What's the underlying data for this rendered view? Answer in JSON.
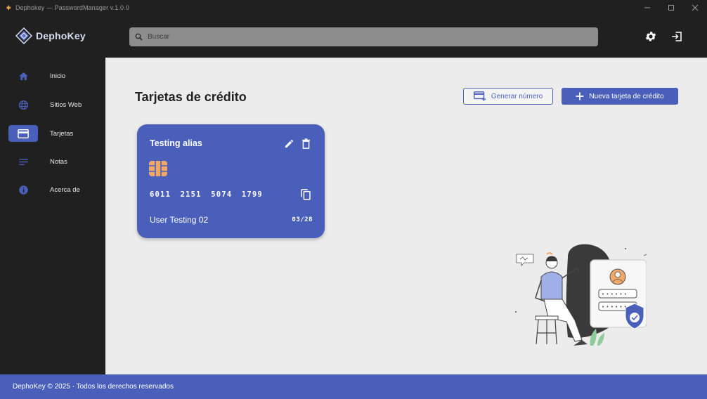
{
  "window": {
    "title": "Dephokey — PasswordManager v.1.0.0",
    "controls": [
      "minimize-icon",
      "maximize-icon",
      "close-icon"
    ]
  },
  "header": {
    "logo_text": "DephoKey",
    "search_placeholder": "Buscar",
    "icons": [
      "gear-icon",
      "logout-icon"
    ]
  },
  "sidebar": {
    "items": [
      {
        "label": "Inicio",
        "icon": "home-icon",
        "active": false
      },
      {
        "label": "Sitios Web",
        "icon": "globe-icon",
        "active": false
      },
      {
        "label": "Tarjetas",
        "icon": "credit-card-icon",
        "active": true
      },
      {
        "label": "Notas",
        "icon": "notes-icon",
        "active": false
      },
      {
        "label": "Acerca de",
        "icon": "info-icon",
        "active": false
      }
    ]
  },
  "main": {
    "title": "Tarjetas de crédito",
    "generate_button": "Generar número",
    "new_card_button": "Nueva tarjeta de crédito",
    "cards": [
      {
        "alias": "Testing alias",
        "number": "6011 2151 5074 1799",
        "holder": "User Testing 02",
        "expiry": "03/28"
      }
    ]
  },
  "footer": {
    "text": "DephoKey © 2025 · Todos los derechos reservados"
  },
  "colors": {
    "accent": "#4a5fba",
    "dark_bg": "#202020",
    "content_bg": "#ececec",
    "chip": "#f0a868"
  }
}
